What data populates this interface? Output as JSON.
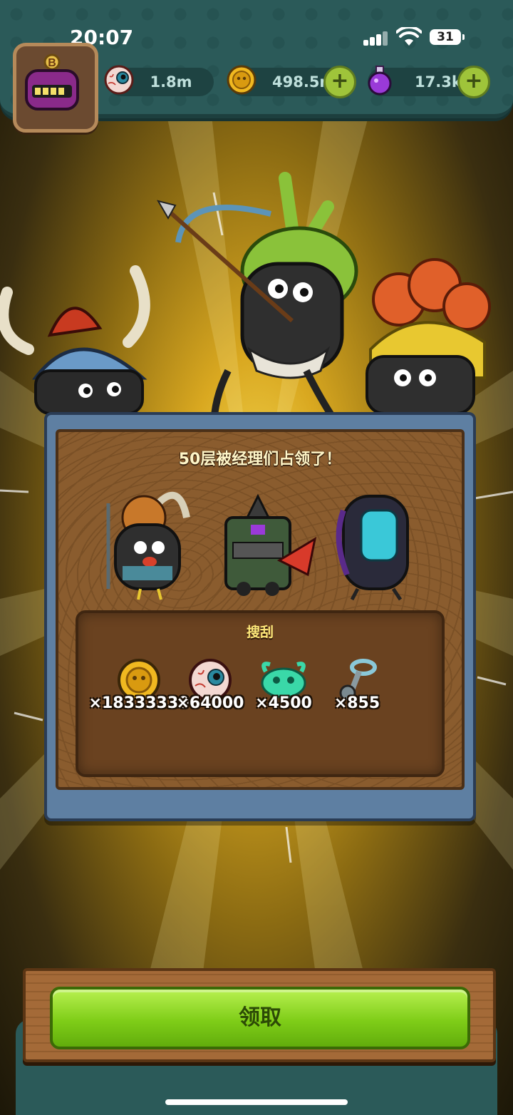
{
  "status_bar": {
    "time": "20:07",
    "battery": "31"
  },
  "resources": {
    "eyeballs": "1.8m",
    "coins": "498.5m",
    "potions": "17.3k"
  },
  "panel": {
    "title": "50层被经理们占领了！"
  },
  "loot": {
    "title": "搜刮",
    "items": [
      {
        "icon": "gold-coin-icon",
        "count": "×18333330"
      },
      {
        "icon": "eyeball-icon",
        "count": "×64000"
      },
      {
        "icon": "green-slime-icon",
        "count": "×4500"
      },
      {
        "icon": "ring-icon",
        "count": "×855"
      }
    ]
  },
  "claim_button": "领取",
  "colors": {
    "top_bar": "#2b5a59",
    "button_green": "#7fcd18",
    "panel_frame": "#5e7fa2"
  }
}
